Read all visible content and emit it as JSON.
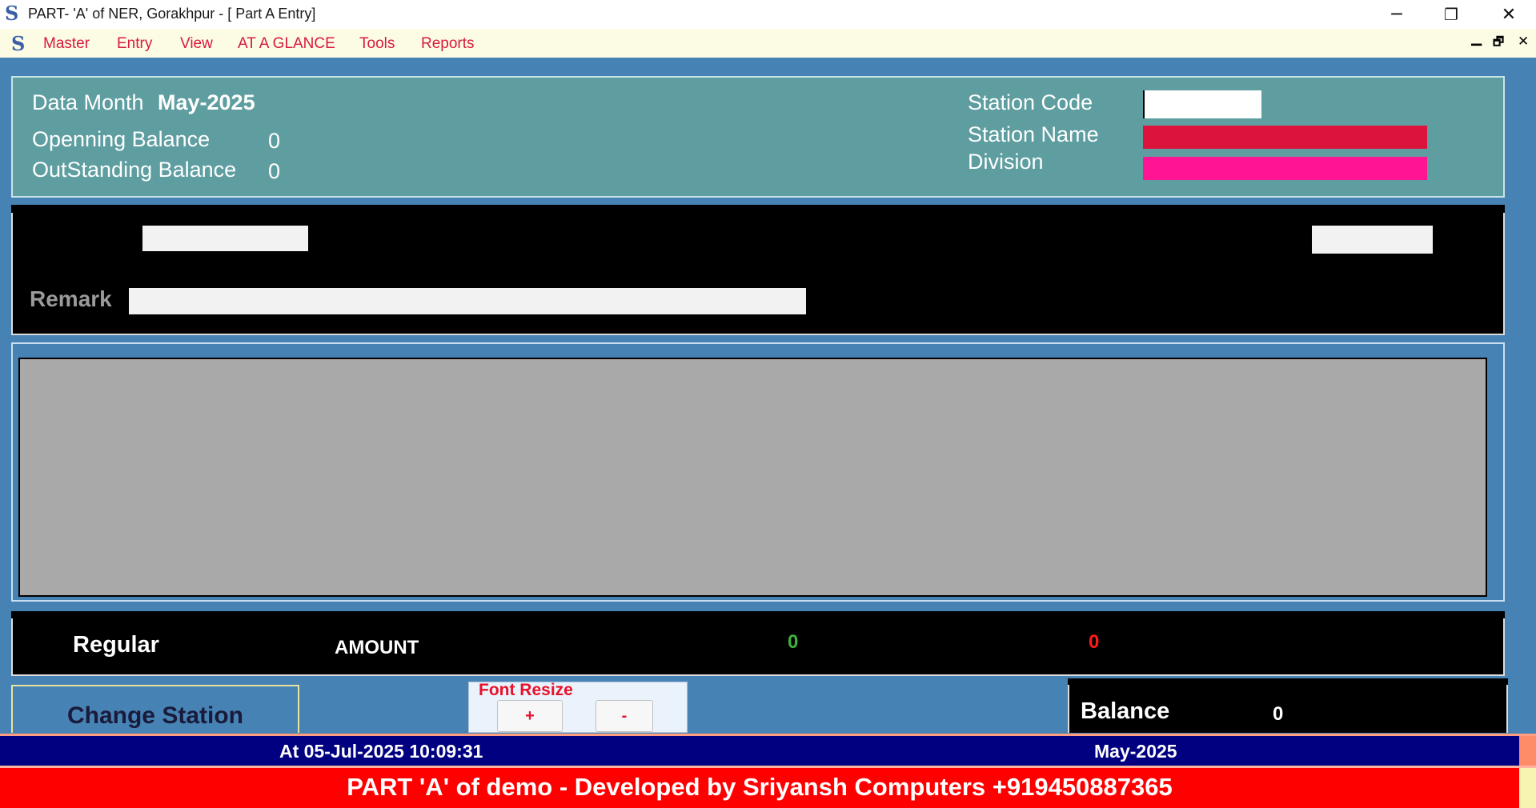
{
  "window": {
    "title": "PART- 'A' of NER, Gorakhpur - [ Part A Entry]",
    "logo_glyph": "S",
    "minimize_glyph": "─",
    "restore_glyph": "❐",
    "close_glyph": "✕"
  },
  "menu": {
    "logo_glyph": "S",
    "items": [
      {
        "label": "Master"
      },
      {
        "label": "Entry"
      },
      {
        "label": "View"
      },
      {
        "label": "AT A GLANCE"
      },
      {
        "label": "Tools"
      },
      {
        "label": "Reports"
      }
    ],
    "mdi_minimize": "▁",
    "mdi_restore": "🗗",
    "mdi_close": "✕"
  },
  "header": {
    "data_month_label": "Data Month",
    "data_month_value": "May-2025",
    "opening_balance_label": "Openning Balance",
    "opening_balance_value": "0",
    "outstanding_balance_label": "OutStanding Balance",
    "outstanding_balance_value": "0",
    "station_code_label": "Station Code",
    "station_code_value": "",
    "station_name_label": "Station Name",
    "station_name_value": "",
    "division_label": "Division",
    "division_value": ""
  },
  "entry": {
    "field1_value": "",
    "field2_value": "",
    "remark_label": "Remark",
    "remark_value": ""
  },
  "totals": {
    "type_label": "Regular",
    "amount_label": "AMOUNT",
    "value_green": "0",
    "value_red": "0"
  },
  "controls": {
    "change_station_label": "Change Station",
    "font_resize_label": "Font Resize",
    "font_increase_label": "+",
    "font_decrease_label": "-",
    "balance_label": "Balance",
    "balance_value": "0"
  },
  "status": {
    "timestamp": "At 05-Jul-2025 10:09:31",
    "month": "May-2025",
    "footer": "PART 'A' of demo - Developed by Sriyansh Computers +919450887365"
  },
  "colors": {
    "background": "#4682b4",
    "header_panel": "#5f9ea0",
    "station_name_fill": "#dc143c",
    "division_fill": "#ff1493",
    "menu_text": "#d81b3c",
    "status_bar": "#000080",
    "footer_bar": "#ff0000",
    "value_green": "#3cb43c",
    "value_red": "#ff1a1a"
  }
}
